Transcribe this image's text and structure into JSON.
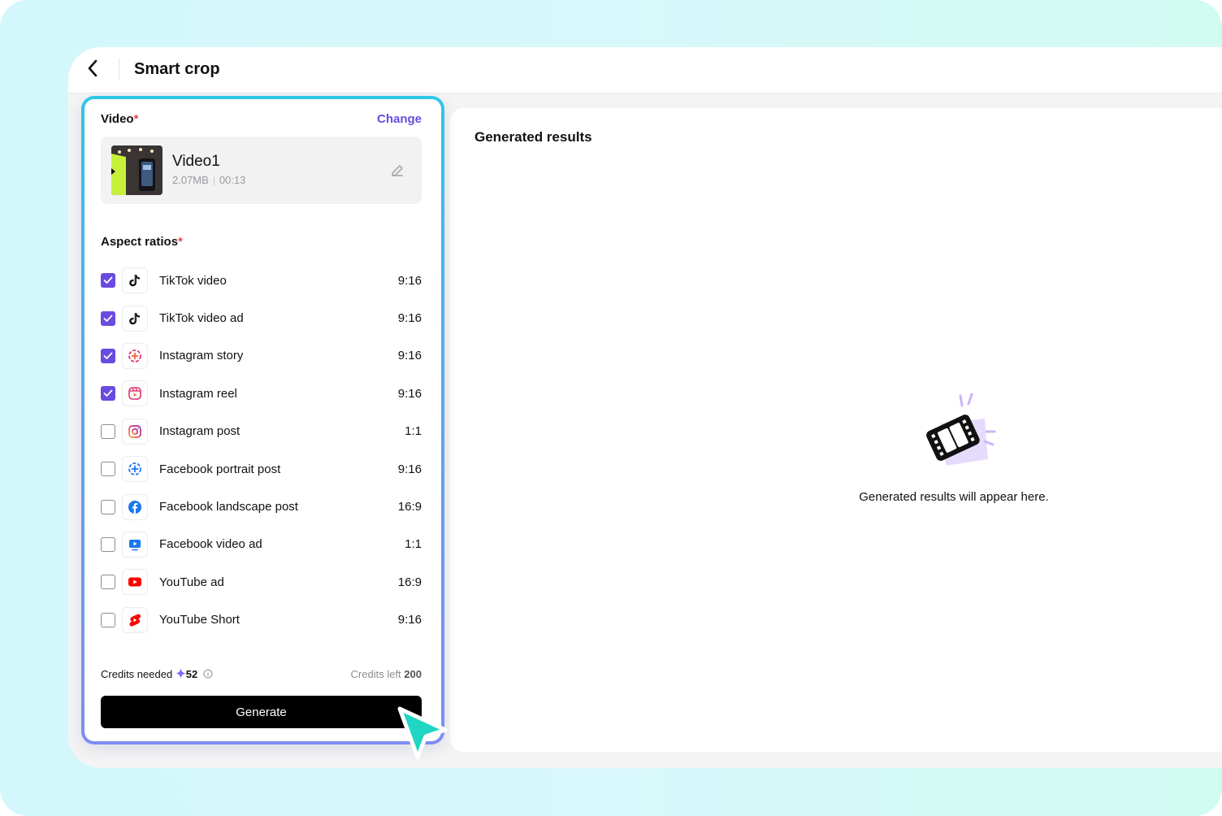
{
  "header": {
    "title": "Smart crop"
  },
  "video_section": {
    "label": "Video",
    "required_mark": "*",
    "change_label": "Change",
    "video": {
      "name": "Video1",
      "size": "2.07MB",
      "duration": "00:13"
    }
  },
  "aspect_section": {
    "label": "Aspect ratios",
    "required_mark": "*",
    "items": [
      {
        "label": "TikTok video",
        "ratio": "9:16",
        "checked": true,
        "icon": "tiktok-icon"
      },
      {
        "label": "TikTok video ad",
        "ratio": "9:16",
        "checked": true,
        "icon": "tiktok-icon"
      },
      {
        "label": "Instagram story",
        "ratio": "9:16",
        "checked": true,
        "icon": "instagram-story-icon"
      },
      {
        "label": "Instagram reel",
        "ratio": "9:16",
        "checked": true,
        "icon": "instagram-reel-icon"
      },
      {
        "label": "Instagram post",
        "ratio": "1:1",
        "checked": false,
        "icon": "instagram-icon"
      },
      {
        "label": "Facebook portrait post",
        "ratio": "9:16",
        "checked": false,
        "icon": "facebook-story-icon"
      },
      {
        "label": "Facebook landscape post",
        "ratio": "16:9",
        "checked": false,
        "icon": "facebook-icon"
      },
      {
        "label": "Facebook video ad",
        "ratio": "1:1",
        "checked": false,
        "icon": "facebook-video-icon"
      },
      {
        "label": "YouTube ad",
        "ratio": "16:9",
        "checked": false,
        "icon": "youtube-icon"
      },
      {
        "label": "YouTube Short",
        "ratio": "9:16",
        "checked": false,
        "icon": "youtube-shorts-icon"
      }
    ]
  },
  "credits": {
    "needed_label": "Credits needed",
    "needed_value": "52",
    "left_label": "Credits left",
    "left_value": "200"
  },
  "generate_label": "Generate",
  "results": {
    "title": "Generated results",
    "empty_message": "Generated results will appear here."
  },
  "colors": {
    "accent": "#6a4be0",
    "required": "#e5484d",
    "button": "#000000"
  }
}
